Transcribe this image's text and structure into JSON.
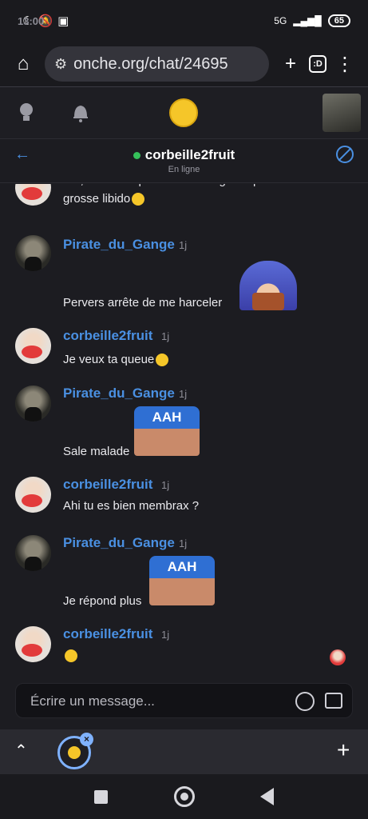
{
  "status": {
    "time": "13:00",
    "network": "5G",
    "battery": "65"
  },
  "browser": {
    "url": "onche.org/chat/24695",
    "tabs_label": ":D"
  },
  "chat": {
    "title": "corbeille2fruit",
    "subtitle": "En ligne"
  },
  "messages": [
    {
      "author": "",
      "time": "",
      "text": "Ahi, c'est sûr que tu es sauvage et que tu as une grosse libido"
    },
    {
      "author": "Pirate_du_Gange",
      "time": "1j",
      "text": "Pervers arrête de me harceler"
    },
    {
      "author": "corbeille2fruit",
      "time": "1j",
      "text": "Je veux ta queue"
    },
    {
      "author": "Pirate_du_Gange",
      "time": "1j",
      "text": "Sale malade",
      "sticker": "AAH"
    },
    {
      "author": "corbeille2fruit",
      "time": "1j",
      "text": "Ahi tu es bien membrax ?"
    },
    {
      "author": "Pirate_du_Gange",
      "time": "1j",
      "text": "Je répond plus",
      "sticker": "AAH"
    },
    {
      "author": "corbeille2fruit",
      "time": "1j",
      "text": ""
    }
  ],
  "composer": {
    "placeholder": "Écrire un message..."
  },
  "colors": {
    "accent": "#4a90e2",
    "online": "#35c05a",
    "background": "#1c1c21"
  }
}
